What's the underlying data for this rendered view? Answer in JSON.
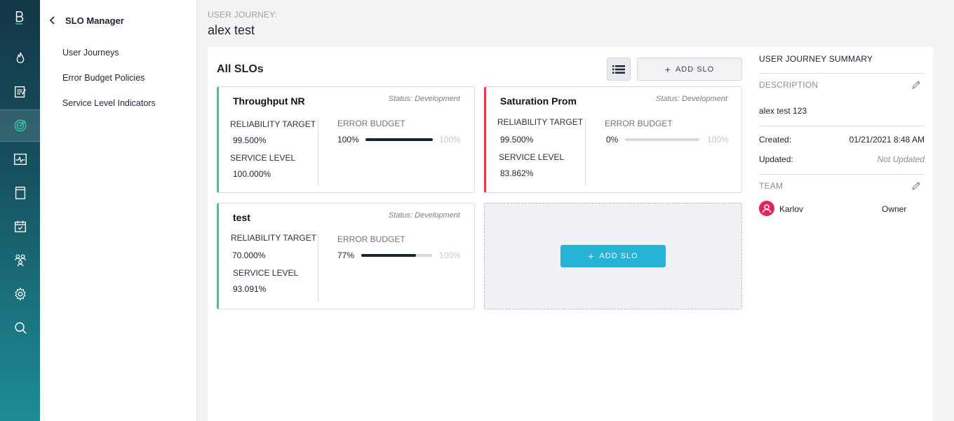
{
  "nav": {
    "icons": [
      "logo-icon",
      "fire-icon",
      "notes-icon",
      "target-icon",
      "activity-icon",
      "book-icon",
      "calendar-check-icon",
      "team-icon",
      "settings-icon",
      "search-icon"
    ],
    "active": "target-icon"
  },
  "sidebar": {
    "title": "SLO Manager",
    "items": [
      {
        "label": "User Journeys"
      },
      {
        "label": "Error Budget Policies"
      },
      {
        "label": "Service Level Indicators"
      }
    ]
  },
  "header": {
    "breadcrumb": "USER JOURNEY:",
    "title": "alex test"
  },
  "slos": {
    "title": "All SLOs",
    "add_label": "ADD SLO",
    "cards": [
      {
        "name": "Throughput NR",
        "status": "Status: Development",
        "reliability_label": "RELIABILITY TARGET",
        "reliability": "99.500%",
        "service_label": "SERVICE LEVEL",
        "service": "100.000%",
        "budget_label": "ERROR BUDGET",
        "budget": "100%",
        "budget_fraction": 1.0,
        "budget_max": "100%",
        "accent": "#3cc3a0"
      },
      {
        "name": "Saturation Prom",
        "status": "Status: Development",
        "reliability_label": "RELIABILITY TARGET",
        "reliability": "99.500%",
        "service_label": "SERVICE LEVEL",
        "service": "83.862%",
        "budget_label": "ERROR BUDGET",
        "budget": "0%",
        "budget_fraction": 0.0,
        "budget_max": "100%",
        "accent": "#e03c4b"
      },
      {
        "name": "test",
        "status": "Status: Development",
        "reliability_label": "RELIABILITY TARGET",
        "reliability": "70.000%",
        "service_label": "SERVICE LEVEL",
        "service": "93.091%",
        "budget_label": "ERROR BUDGET",
        "budget": "77%",
        "budget_fraction": 0.77,
        "budget_max": "100%",
        "accent": "#3cc3a0"
      }
    ],
    "empty_add_label": "ADD SLO"
  },
  "summary": {
    "title": "USER JOURNEY SUMMARY",
    "description_label": "DESCRIPTION",
    "description": "alex test 123",
    "created_label": "Created:",
    "created": "01/21/2021 8:48 AM",
    "updated_label": "Updated:",
    "updated": "Not Updated",
    "team_label": "TEAM",
    "member": {
      "name": "Karlov",
      "role": "Owner"
    }
  },
  "colors": {
    "primary": "#26b3d5",
    "rail_top": "#133746",
    "rail_bottom": "#1d8c93"
  }
}
